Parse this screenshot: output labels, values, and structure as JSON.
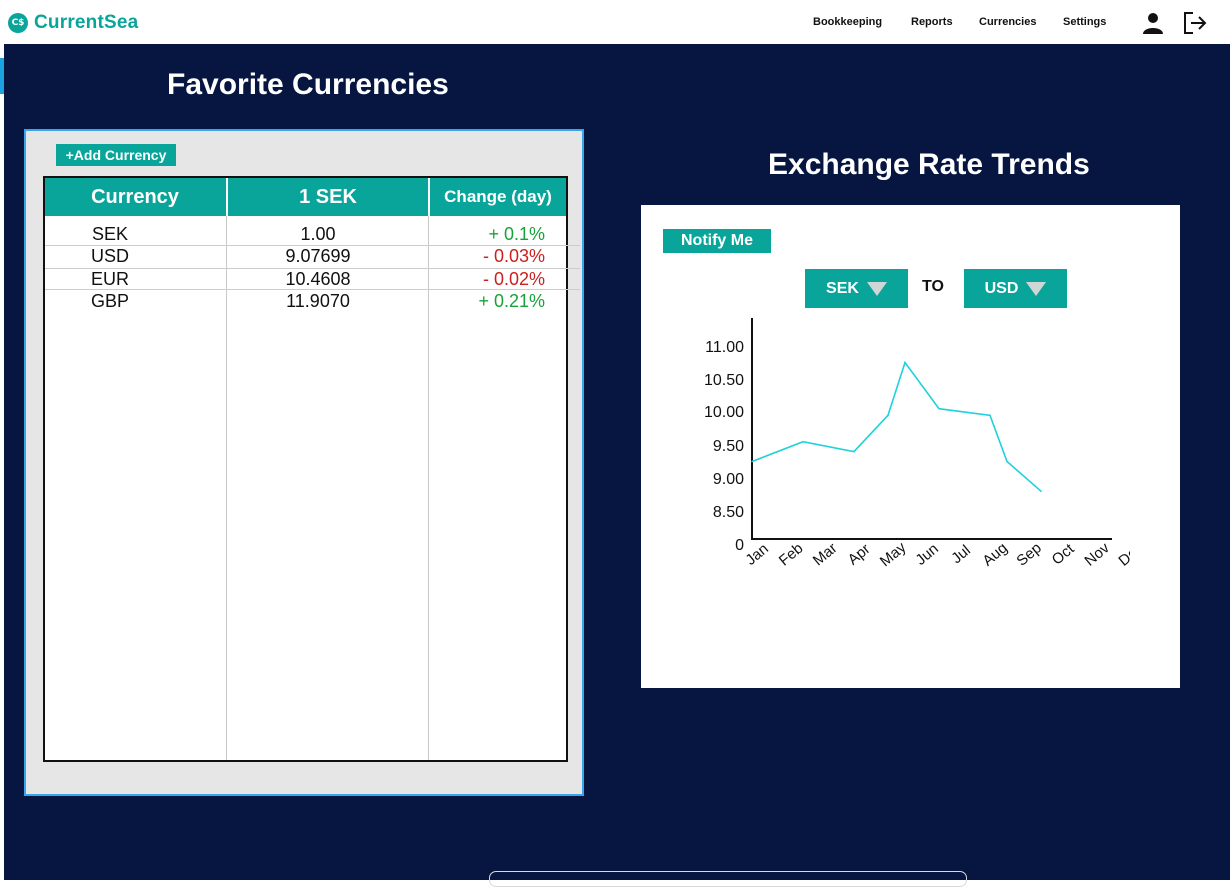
{
  "app": {
    "name": "CurrentSea",
    "logo_mark": "C$"
  },
  "nav": [
    "Bookkeeping",
    "Reports",
    "Currencies",
    "Settings"
  ],
  "icons": {
    "user": "user-icon",
    "logout": "logout-icon"
  },
  "colors": {
    "accent": "#0aa59a",
    "background": "#061641",
    "positive": "#17a33a",
    "negative": "#cc1f1f",
    "line": "#1fd1dc"
  },
  "favorites": {
    "title": "Favorite Currencies",
    "add_label": "+Add Currency",
    "headers": [
      "Currency",
      "1 SEK",
      "Change (day)"
    ],
    "rows": [
      {
        "code": "SEK",
        "rate": "1.00",
        "change": "+ 0.1%",
        "direction": "up"
      },
      {
        "code": "USD",
        "rate": "9.07699",
        "change": "- 0.03%",
        "direction": "down"
      },
      {
        "code": "EUR",
        "rate": "10.4608",
        "change": "- 0.02%",
        "direction": "down"
      },
      {
        "code": "GBP",
        "rate": "11.9070",
        "change": "+ 0.21%",
        "direction": "up"
      }
    ]
  },
  "trends": {
    "title": "Exchange Rate Trends",
    "notify_label": "Notify Me",
    "from_currency": "SEK",
    "to_label": "TO",
    "to_currency": "USD"
  },
  "chart_data": {
    "type": "line",
    "title": "",
    "xlabel": "",
    "ylabel": "",
    "categories": [
      "Jan",
      "Feb",
      "Mar",
      "Apr",
      "May",
      "Jun",
      "Jul",
      "Aug",
      "Sep",
      "Oct",
      "Nov",
      "Dec"
    ],
    "y_ticks": [
      "11.00",
      "10.50",
      "10.00",
      "9.50",
      "9.00",
      "8.50",
      "0"
    ],
    "y_tick_values": [
      11.0,
      10.5,
      10.0,
      9.5,
      9.0,
      8.5,
      8.0
    ],
    "values": [
      9.25,
      9.55,
      9.4,
      9.95,
      10.75,
      10.05,
      9.95,
      9.25,
      8.8
    ],
    "x_positions": [
      0,
      1.5,
      3,
      4,
      4.5,
      5.5,
      7,
      7.5,
      8.5
    ],
    "grid": false,
    "legend": "none"
  }
}
